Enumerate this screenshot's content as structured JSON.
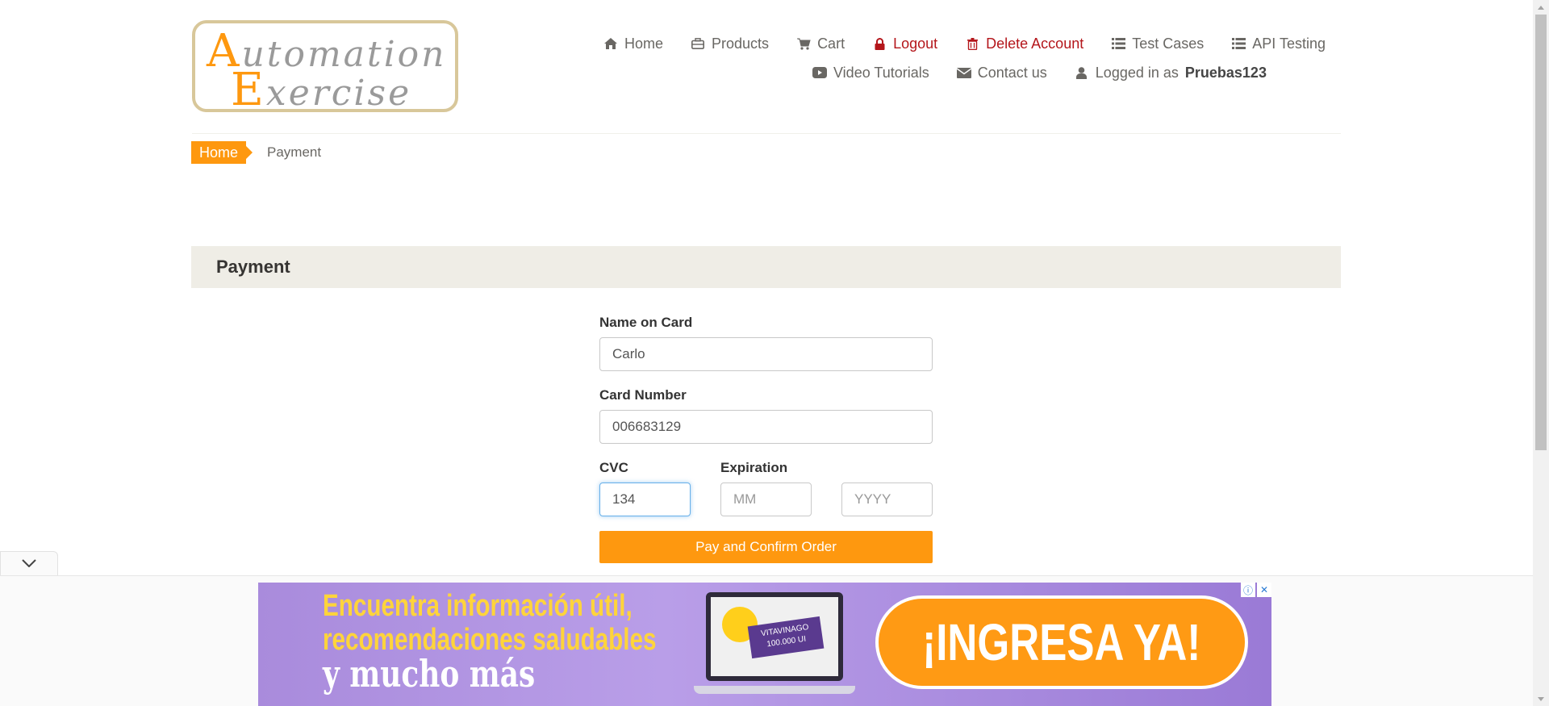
{
  "logo": {
    "line1_cap": "A",
    "line1_rest": "utomation",
    "line2_cap": "E",
    "line2_rest": "xercise"
  },
  "nav": {
    "row1": [
      {
        "label": "Home",
        "icon": "home-icon",
        "danger": false
      },
      {
        "label": "Products",
        "icon": "briefcase-icon",
        "danger": false
      },
      {
        "label": "Cart",
        "icon": "cart-icon",
        "danger": false
      },
      {
        "label": "Logout",
        "icon": "lock-icon",
        "danger": true
      },
      {
        "label": "Delete Account",
        "icon": "trash-icon",
        "danger": true
      },
      {
        "label": "Test Cases",
        "icon": "list-icon",
        "danger": false
      },
      {
        "label": "API Testing",
        "icon": "list-icon",
        "danger": false
      }
    ],
    "row2": [
      {
        "label": "Video Tutorials",
        "icon": "youtube-icon"
      },
      {
        "label": "Contact us",
        "icon": "envelope-icon"
      }
    ],
    "logged_in_prefix": "Logged in as",
    "logged_in_user": "Pruebas123"
  },
  "breadcrumb": {
    "home": "Home",
    "current": "Payment"
  },
  "payment": {
    "heading": "Payment",
    "name_label": "Name on Card",
    "name_value": "Carlo",
    "card_label": "Card Number",
    "card_value": "006683129",
    "cvc_label": "CVC",
    "cvc_value": "134",
    "expiration_label": "Expiration",
    "mm_placeholder": "MM",
    "yyyy_placeholder": "YYYY",
    "pay_button": "Pay and Confirm Order"
  },
  "ad": {
    "line1": "Encuentra información útil,",
    "line2": "recomendaciones saludables",
    "line3": "y mucho más",
    "cta": "¡INGRESA YA!",
    "badge": "VITAVINAGO 100.000 UI"
  },
  "colors": {
    "accent": "#FE980F",
    "danger": "#B4161B",
    "heading_bg": "#EFEDE6",
    "ad_bg": "#A98BDC"
  }
}
